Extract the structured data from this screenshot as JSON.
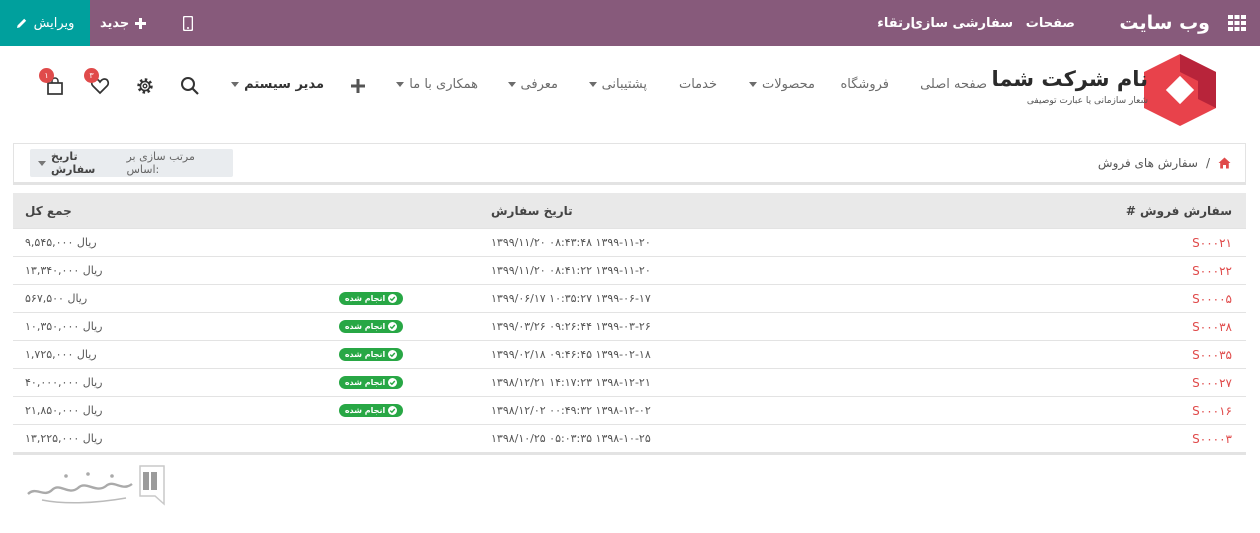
{
  "topbar": {
    "edit_label": "ویرایش",
    "new_label": "جدید",
    "menu": [
      "ارتقاء",
      "سفارشی سازی",
      "صفحات"
    ],
    "brand": "وب سایت"
  },
  "header": {
    "logo_name": "نام شرکت شما",
    "logo_slogan": "شعار سازمانی یا عبارت توصیفی",
    "nav": {
      "home": "صفحه اصلی",
      "shop": "فروشگاه",
      "products": "محصولات",
      "services": "خدمات",
      "support": "پشتیبانی",
      "intro": "معرفی",
      "collab": "همکاری با ما",
      "admin": "مدیر سیستم"
    },
    "wishlist_count": "۳",
    "cart_count": "۱"
  },
  "breadcrumb": {
    "current": "سفارش های فروش",
    "sort_prefix": "مرتب سازی بر اساس:",
    "sort_value": "تاریخ سفارش"
  },
  "table": {
    "headers": {
      "number": "سفارش فروش #",
      "date": "تاریخ سفارش",
      "total": "جمع کل"
    },
    "done_label": "انجام شده",
    "rows": [
      {
        "number": "S۰۰۰۲۱",
        "date": "۱۳۹۹/۱۱/۲۰  ۰۸:۴۳:۴۸ ۱۳۹۹-۱۱-۲۰",
        "total": "۹,۵۴۵,۰۰۰ ریال",
        "done": false
      },
      {
        "number": "S۰۰۰۲۲",
        "date": "۱۳۹۹/۱۱/۲۰  ۰۸:۴۱:۲۲ ۱۳۹۹-۱۱-۲۰",
        "total": "۱۳,۳۴۰,۰۰۰ ریال",
        "done": false
      },
      {
        "number": "S۰۰۰۰۵",
        "date": "۱۳۹۹/۰۶/۱۷  ۱۰:۳۵:۲۷ ۱۳۹۹-۰۶-۱۷",
        "total": "۵۶۷,۵۰۰ ریال",
        "done": true
      },
      {
        "number": "S۰۰۰۳۸",
        "date": "۱۳۹۹/۰۳/۲۶  ۰۹:۲۶:۴۴ ۱۳۹۹-۰۳-۲۶",
        "total": "۱۰,۳۵۰,۰۰۰ ریال",
        "done": true
      },
      {
        "number": "S۰۰۰۳۵",
        "date": "۱۳۹۹/۰۲/۱۸  ۰۹:۴۶:۴۵ ۱۳۹۹-۰۲-۱۸",
        "total": "۱,۷۲۵,۰۰۰ ریال",
        "done": true
      },
      {
        "number": "S۰۰۰۲۷",
        "date": "۱۳۹۸/۱۲/۲۱  ۱۴:۱۷:۲۳ ۱۳۹۸-۱۲-۲۱",
        "total": "۴۰,۰۰۰,۰۰۰ ریال",
        "done": true
      },
      {
        "number": "S۰۰۰۱۶",
        "date": "۱۳۹۸/۱۲/۰۲  ۰۰:۴۹:۳۲ ۱۳۹۸-۱۲-۰۲",
        "total": "۲۱,۸۵۰,۰۰۰ ریال",
        "done": true
      },
      {
        "number": "S۰۰۰۰۳",
        "date": "۱۳۹۸/۱۰/۲۵  ۰۵:۰۳:۳۵ ۱۳۹۸-۱۰-۲۵",
        "total": "۱۳,۲۲۵,۰۰۰ ریال",
        "done": false
      }
    ]
  },
  "colors": {
    "topbar": "#875a7b",
    "edit": "#00a09d",
    "link": "#e04b4b",
    "done_badge": "#28a745"
  }
}
